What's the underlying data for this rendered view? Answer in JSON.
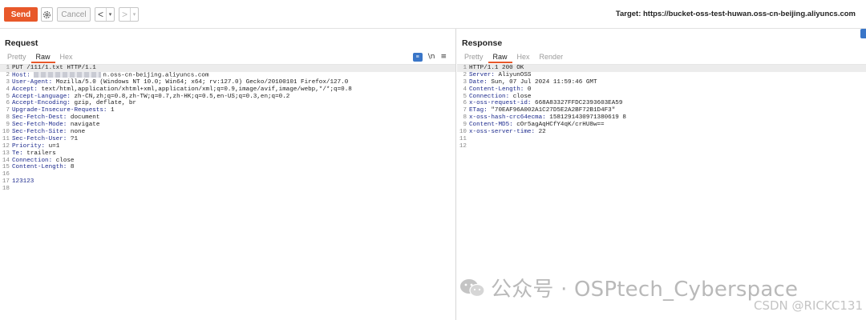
{
  "toolbar": {
    "send_label": "Send",
    "cancel_label": "Cancel",
    "back_arrow": "<",
    "forward_arrow": ">",
    "dropdown_caret": "▾",
    "target_text": "Target: https://bucket-oss-test-huwan.oss-cn-beijing.aliyuncs.com",
    "icons": [
      "settings-icon",
      "chevron-left-icon",
      "chevron-right-icon",
      "dropdown-icon"
    ]
  },
  "request": {
    "title": "Request",
    "tabs": [
      {
        "label": "Pretty",
        "active": false
      },
      {
        "label": "Raw",
        "active": true
      },
      {
        "label": "Hex",
        "active": false
      }
    ],
    "tools": {
      "wrap_label": "\\n",
      "menu_label": "≡"
    },
    "lines": [
      {
        "n": "1",
        "text": "PUT /111/1.txt HTTP/1.1"
      },
      {
        "n": "2",
        "key": "Host:",
        "value": "n.oss-cn-beijing.aliyuncs.com",
        "redacted": true
      },
      {
        "n": "3",
        "key": "User-Agent:",
        "value": "Mozilla/5.0 (Windows NT 10.0; Win64; x64; rv:127.0) Gecko/20100101 Firefox/127.0"
      },
      {
        "n": "4",
        "key": "Accept:",
        "value": "text/html,application/xhtml+xml,application/xml;q=0.9,image/avif,image/webp,*/*;q=0.8"
      },
      {
        "n": "5",
        "key": "Accept-Language:",
        "value": "zh-CN,zh;q=0.8,zh-TW;q=0.7,zh-HK;q=0.5,en-US;q=0.3,en;q=0.2"
      },
      {
        "n": "6",
        "key": "Accept-Encoding:",
        "value": "gzip, deflate, br"
      },
      {
        "n": "7",
        "key": "Upgrade-Insecure-Requests:",
        "value": "1"
      },
      {
        "n": "8",
        "key": "Sec-Fetch-Dest:",
        "value": "document"
      },
      {
        "n": "9",
        "key": "Sec-Fetch-Mode:",
        "value": "navigate"
      },
      {
        "n": "10",
        "key": "Sec-Fetch-Site:",
        "value": "none"
      },
      {
        "n": "11",
        "key": "Sec-Fetch-User:",
        "value": "?1"
      },
      {
        "n": "12",
        "key": "Priority:",
        "value": "u=1"
      },
      {
        "n": "13",
        "key": "Te:",
        "value": "trailers"
      },
      {
        "n": "14",
        "key": "Connection:",
        "value": "close"
      },
      {
        "n": "15",
        "key": "Content-Length:",
        "value": "8"
      },
      {
        "n": "16",
        "text": ""
      },
      {
        "n": "17",
        "text": "123123",
        "body": true
      },
      {
        "n": "18",
        "text": ""
      }
    ]
  },
  "response": {
    "title": "Response",
    "tabs": [
      {
        "label": "Pretty",
        "active": false
      },
      {
        "label": "Raw",
        "active": true
      },
      {
        "label": "Hex",
        "active": false
      },
      {
        "label": "Render",
        "active": false
      }
    ],
    "lines": [
      {
        "n": "1",
        "text": "HTTP/1.1 200 OK"
      },
      {
        "n": "2",
        "key": "Server:",
        "value": "AliyunOSS"
      },
      {
        "n": "3",
        "key": "Date:",
        "value": "Sun, 07 Jul 2024 11:59:46 GMT"
      },
      {
        "n": "4",
        "key": "Content-Length:",
        "value": "0"
      },
      {
        "n": "5",
        "key": "Connection:",
        "value": "close"
      },
      {
        "n": "6",
        "key": "x-oss-request-id:",
        "value": "668A83327FFDC2393603EA59"
      },
      {
        "n": "7",
        "key": "ETag:",
        "value": "\"70EAF96A002A1C27D5E2A2BF72B1D4F3\""
      },
      {
        "n": "8",
        "key": "x-oss-hash-crc64ecma:",
        "value": "1581291430971380619 8"
      },
      {
        "n": "9",
        "key": "Content-MD5:",
        "value": "cOr5agAqHCfY4qK/crHU8w=="
      },
      {
        "n": "10",
        "key": "x-oss-server-time:",
        "value": "22"
      },
      {
        "n": "11",
        "text": ""
      },
      {
        "n": "12",
        "text": ""
      }
    ]
  },
  "watermark": {
    "text": "公众号 · OSPtech_Cyberspace",
    "csdn": "CSDN @RICKC131",
    "logo_icon": "wechat-logo-icon"
  }
}
